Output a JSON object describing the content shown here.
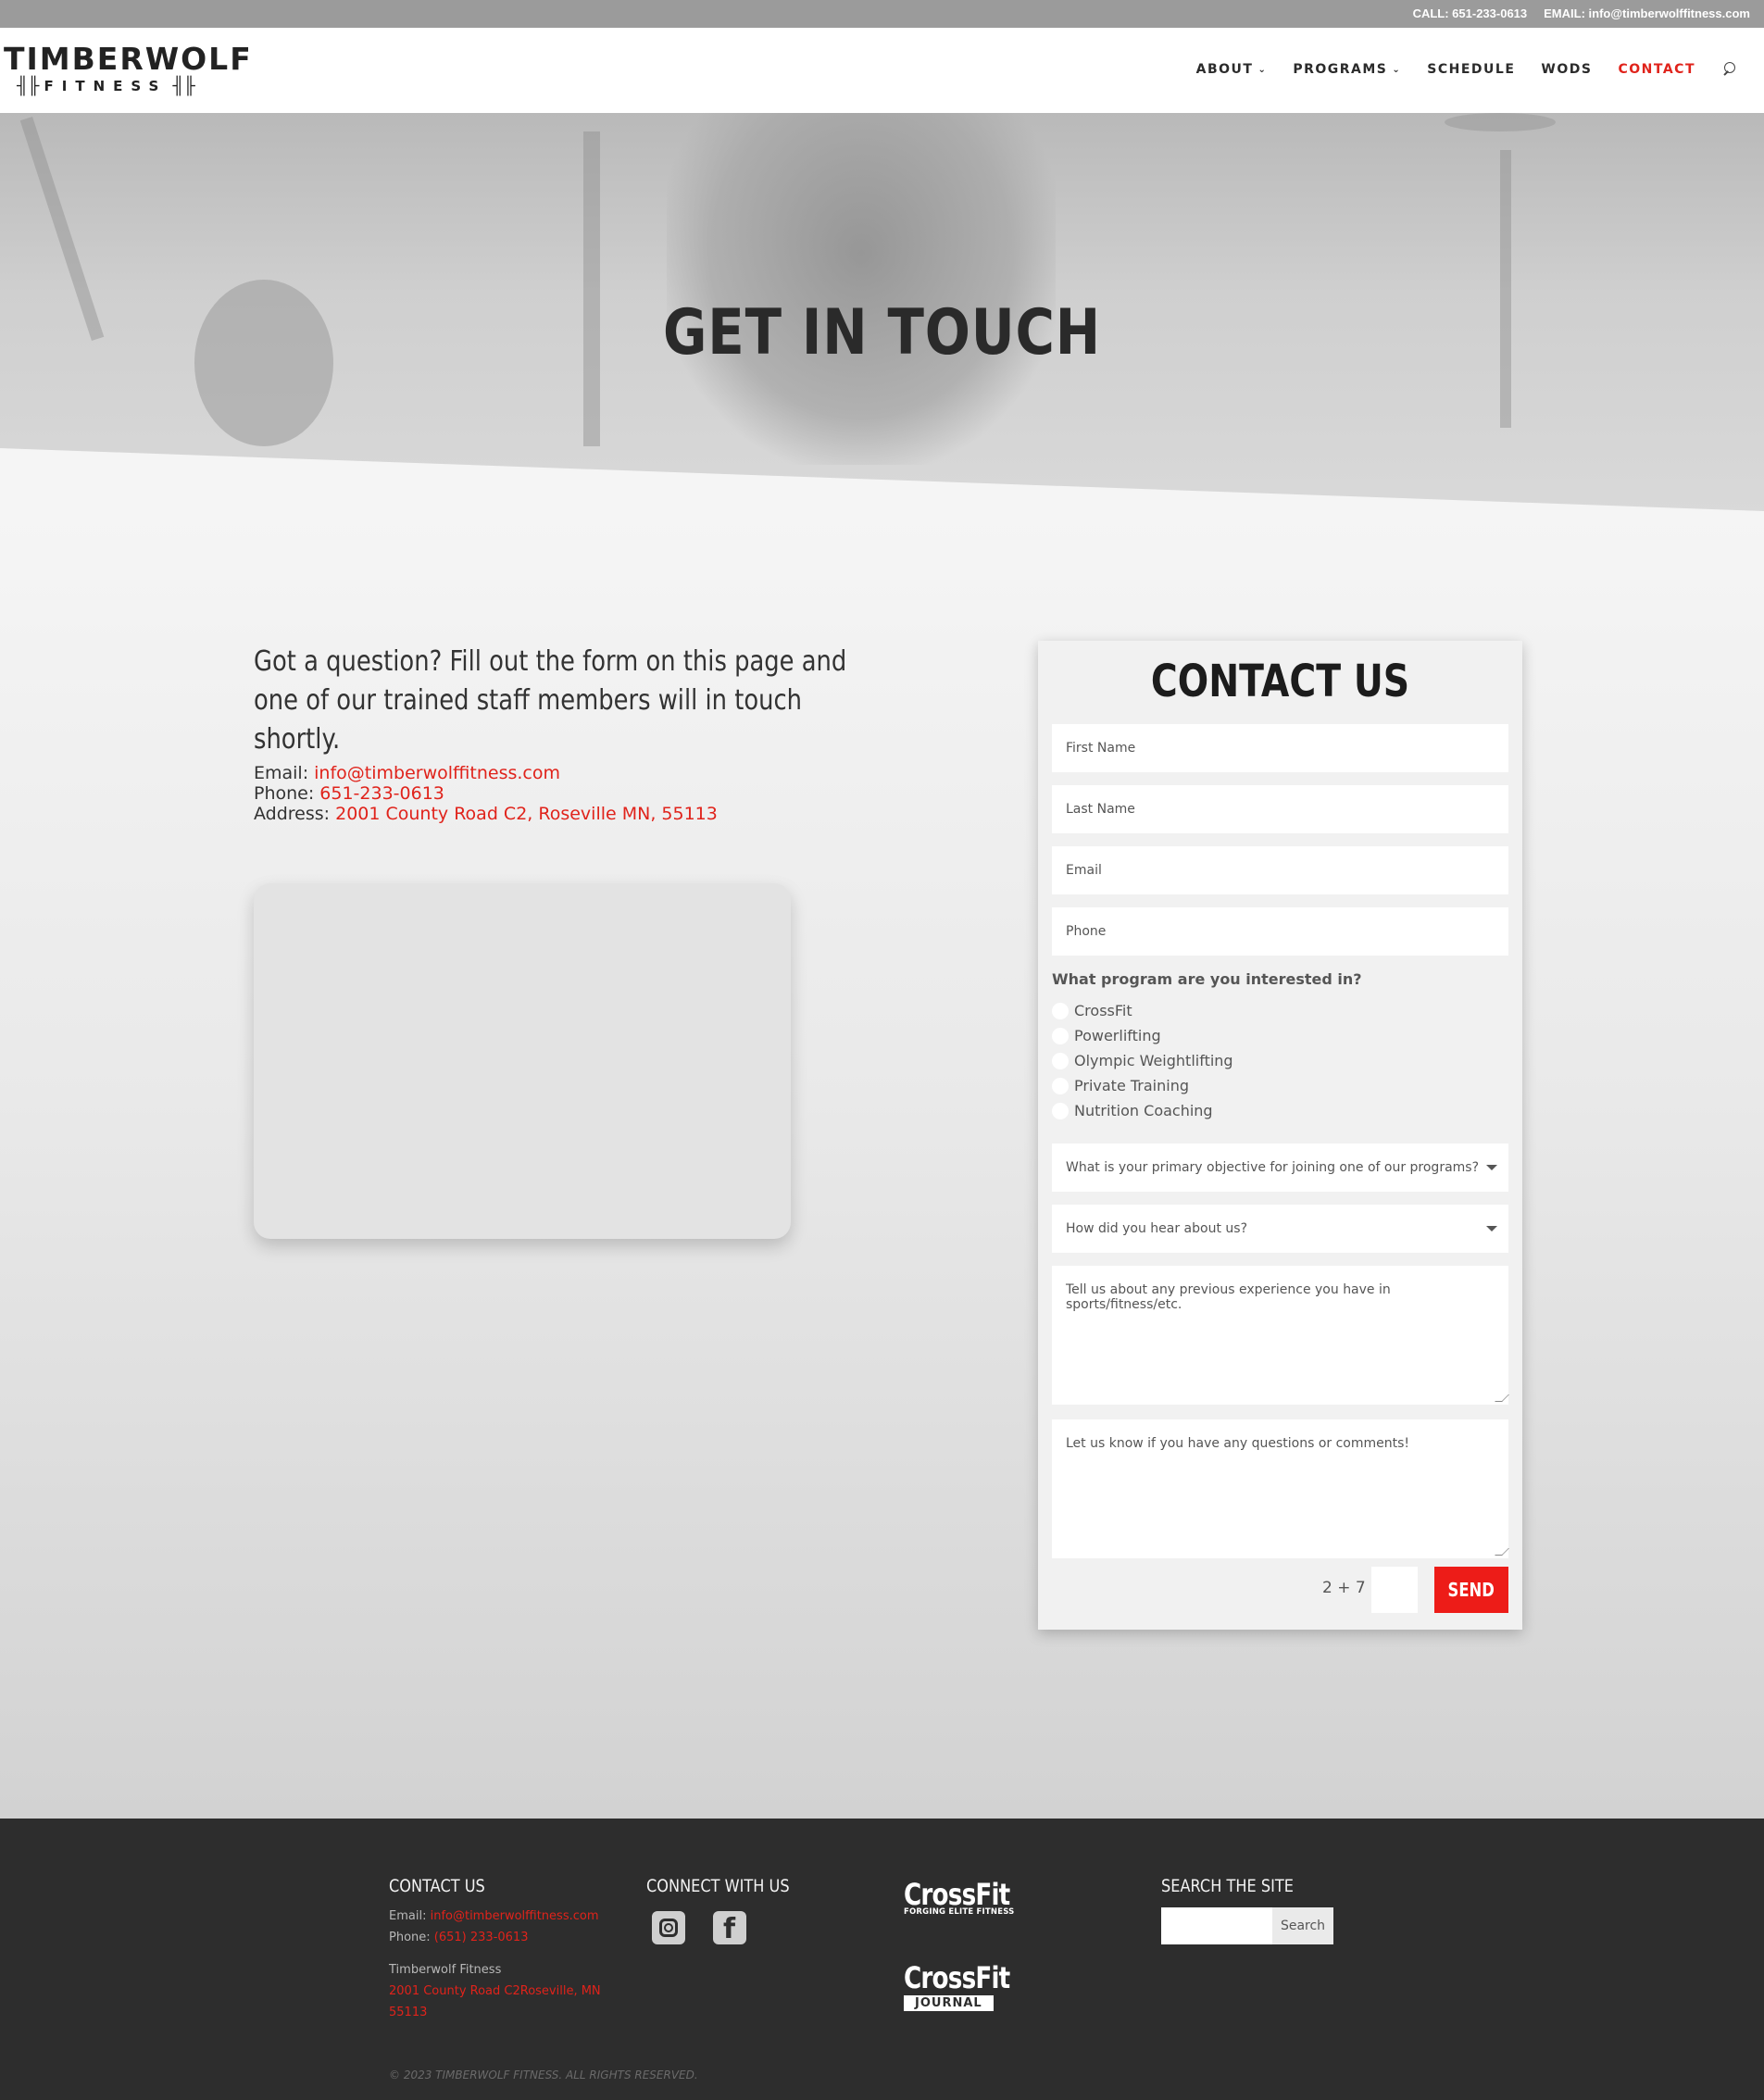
{
  "topbar": {
    "call": "CALL: 651-233-0613",
    "email": "EMAIL: info@timberwolffitness.com"
  },
  "logo": {
    "top": "TIMBERWOLF",
    "bottom": "FITNESS",
    "bar_left": "╢╟",
    "bar_right": "╢╟"
  },
  "nav": {
    "items": [
      {
        "label": "ABOUT",
        "chevron": "⌄"
      },
      {
        "label": "PROGRAMS",
        "chevron": "⌄"
      },
      {
        "label": "SCHEDULE"
      },
      {
        "label": "WODS"
      },
      {
        "label": "CONTACT",
        "active": true
      }
    ]
  },
  "hero": {
    "title": "GET IN TOUCH"
  },
  "intro": {
    "text": "Got a question? Fill out the form on this page and one of our trained staff members will in touch shortly."
  },
  "contact": {
    "email_label": "Email: ",
    "email": "info@timberwolffitness.com",
    "phone_label": "Phone: ",
    "phone": "651-233-0613",
    "address_label": "Address: ",
    "address": "2001 County Road C2, Roseville MN, 55113"
  },
  "form": {
    "title": "CONTACT US",
    "first_name": "First Name",
    "last_name": "Last Name",
    "email": "Email",
    "phone": "Phone",
    "program_question": "What program are you interested in?",
    "programs": [
      "CrossFit",
      "Powerlifting",
      "Olympic Weightlifting",
      "Private Training",
      "Nutrition Coaching"
    ],
    "objective": "What is your primary objective for joining one of our programs?",
    "hear": "How did you hear about us?",
    "experience": "Tell us about any previous experience you have in sports/fitness/etc.",
    "questions": "Let us know if you have any questions or comments!",
    "captcha": "2 + 7 =",
    "send": "SEND"
  },
  "footer": {
    "contact_head": "CONTACT US",
    "email_label": "Email: ",
    "email": "info@timberwolffitness.com",
    "phone_label": "Phone: ",
    "phone": "(651) 233-0613",
    "company": "Timberwolf Fitness",
    "address_line1": "2001 County Road C2Roseville, MN",
    "address_line2": "55113",
    "connect_head": "CONNECT WITH US",
    "social_icons": [
      "instagram-icon",
      "facebook-icon"
    ],
    "crossfit_1": "CrossFit",
    "crossfit_1_sub": "FORGING ELITE FITNESS",
    "crossfit_2": "CrossFit",
    "crossfit_2_sub": "JOURNAL",
    "search_head": "SEARCH THE SITE",
    "search_btn": "Search",
    "copyright": "© 2023 TIMBERWOLF FITNESS. ALL RIGHTS RESERVED."
  },
  "colors": {
    "accent": "#e0231b",
    "footer_bg": "#2d2d2d",
    "topbar_bg": "#9b9b9b"
  }
}
